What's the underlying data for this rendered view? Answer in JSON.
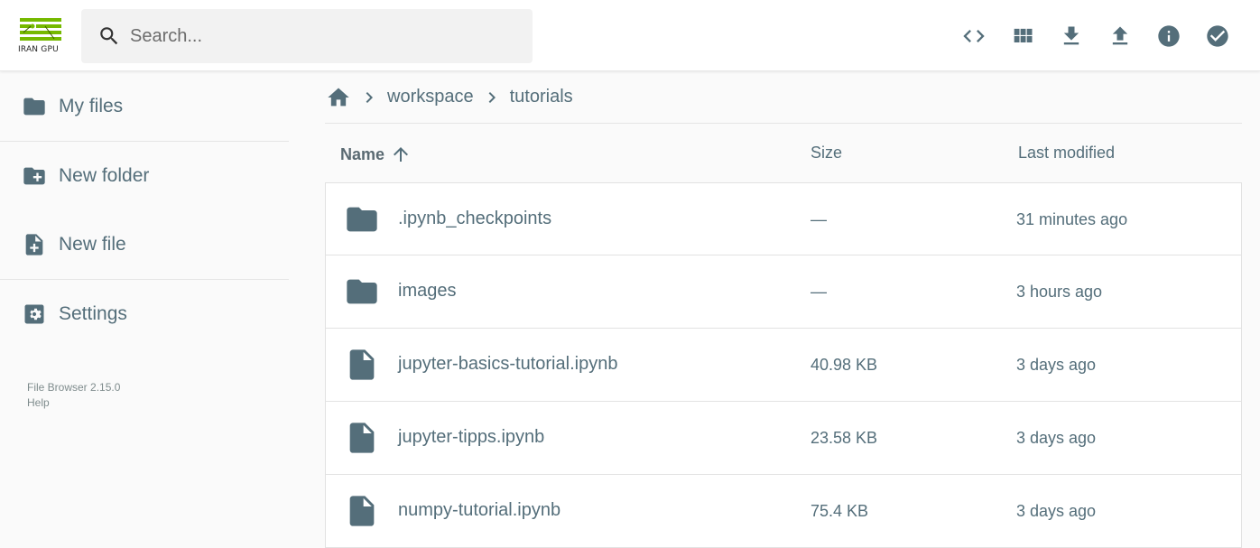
{
  "app": {
    "logo_text": "IRAN GPU",
    "brand_color": "#76b900"
  },
  "search": {
    "placeholder": "Search...",
    "value": ""
  },
  "toolbar": {
    "buttons": [
      {
        "icon": "code-icon"
      },
      {
        "icon": "grid-view-icon"
      },
      {
        "icon": "download-icon"
      },
      {
        "icon": "upload-icon"
      },
      {
        "icon": "info-icon"
      },
      {
        "icon": "check-circle-icon"
      }
    ]
  },
  "sidebar": {
    "items": [
      {
        "label": "My files",
        "icon": "folder-icon"
      },
      {
        "label": "New folder",
        "icon": "create-new-folder-icon"
      },
      {
        "label": "New file",
        "icon": "note-add-icon"
      },
      {
        "label": "Settings",
        "icon": "settings-icon"
      }
    ],
    "credits": {
      "version": "File Browser 2.15.0",
      "help": "Help"
    }
  },
  "breadcrumbs": {
    "home_icon": "home-icon",
    "items": [
      "workspace",
      "tutorials"
    ]
  },
  "listing": {
    "columns": {
      "name": "Name",
      "size": "Size",
      "modified": "Last modified"
    },
    "sort": {
      "column": "name",
      "direction": "ascending"
    },
    "rows": [
      {
        "type": "folder",
        "name": ".ipynb_checkpoints",
        "size": "—",
        "modified": "31 minutes ago"
      },
      {
        "type": "folder",
        "name": "images",
        "size": "—",
        "modified": "3 hours ago"
      },
      {
        "type": "file",
        "name": "jupyter-basics-tutorial.ipynb",
        "size": "40.98 KB",
        "modified": "3 days ago"
      },
      {
        "type": "file",
        "name": "jupyter-tipps.ipynb",
        "size": "23.58 KB",
        "modified": "3 days ago"
      },
      {
        "type": "file",
        "name": "numpy-tutorial.ipynb",
        "size": "75.4 KB",
        "modified": "3 days ago"
      }
    ]
  },
  "colors": {
    "text": "#546e7a",
    "background": "#fafafa",
    "row_background": "#ffffff"
  }
}
